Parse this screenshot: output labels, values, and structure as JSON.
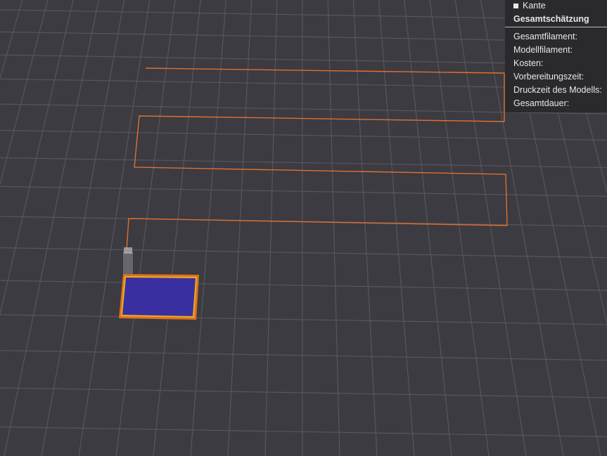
{
  "legend": {
    "item": "Kante",
    "color": "#e8e8e8"
  },
  "estimate": {
    "title": "Gesamtschätzung",
    "rows": [
      "Gesamtfilament:",
      "Modellfilament:",
      "Kosten:",
      "Vorbereitungszeit:",
      "Druckzeit des Modells:",
      "Gesamtdauer:"
    ]
  },
  "colors": {
    "background": "#3b3b41",
    "grid": "#56565c",
    "travel": "#e0702a",
    "model_fill": "#3a2fa0",
    "model_outline": "#e0a020"
  }
}
